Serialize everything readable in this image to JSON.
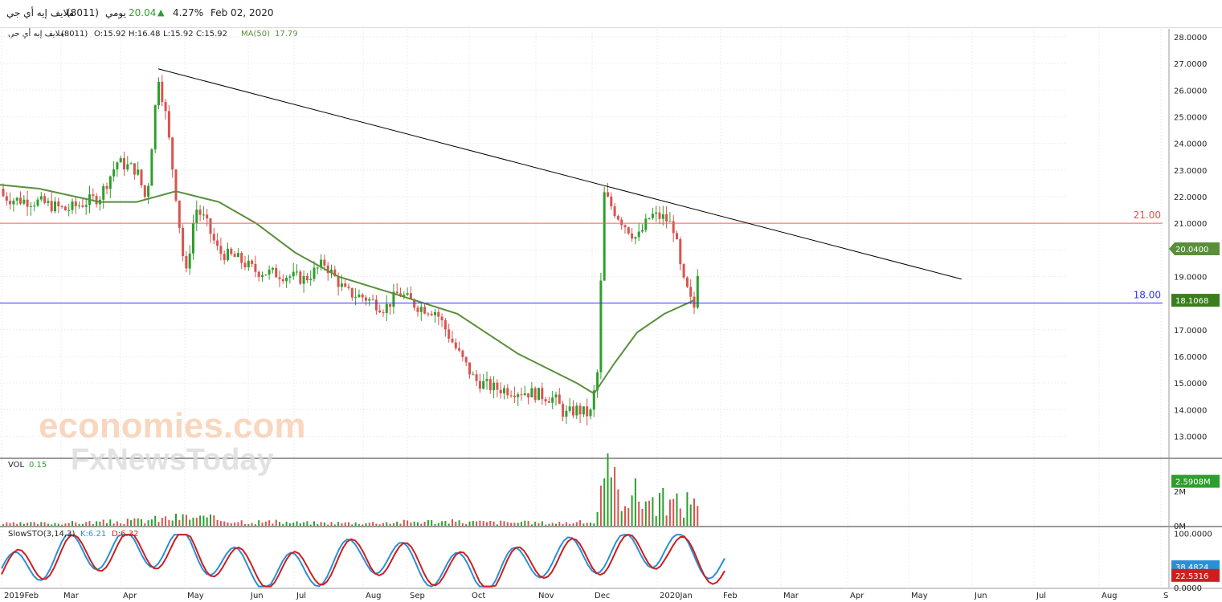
{
  "header": {
    "symbol": "ملايف إيه أي جي",
    "code": "(8011)",
    "period": "يومي",
    "last": "20.04",
    "change_pct": "4.27%",
    "date": "Feb 02, 2020"
  },
  "ohlc_bar": {
    "name": "ملايف إيه أي جي",
    "code": "(8011)",
    "open": "O:15.92",
    "high": "H:16.48",
    "low": "L:15.92",
    "close": "C:15.92",
    "ma_label": "MA(50)",
    "ma_value": "17.79"
  },
  "levels": {
    "resistance": "21.00",
    "support": "18.00"
  },
  "badges": {
    "price": "20.0400",
    "ma": "18.1068",
    "volume": "2.5908M",
    "sto_k": "38.4824",
    "sto_d": "22.5316"
  },
  "vol_panel": {
    "label": "VOL",
    "value": "0.15"
  },
  "sto_panel": {
    "label": "SlowSTO(3,14,3)",
    "k": "K:6.21",
    "d": "D:6.32"
  },
  "watermark": {
    "line1": "economies.com",
    "line2": "FxNewsToday"
  },
  "colors": {
    "up": "#2e9e2e",
    "down": "#d9534f",
    "ma": "#5a8f3a",
    "resistance": "#ff5a5a",
    "support": "#3333ff",
    "trend": "#000000",
    "sto_k": "#2b8fd6",
    "sto_d": "#cc1f1f"
  },
  "chart_data": [
    {
      "type": "candlestick",
      "title": "ملايف إيه أي جي (8011)",
      "x_ticks": [
        "2019Feb",
        "Mar",
        "Apr",
        "May",
        "Jun",
        "Jul",
        "Aug",
        "Sep",
        "Oct",
        "Nov",
        "Dec",
        "2020Jan",
        "Feb",
        "Mar",
        "Apr",
        "May",
        "Jun",
        "Jul",
        "Aug",
        "S"
      ],
      "y_ticks": [
        "28.0000",
        "27.0000",
        "26.0000",
        "25.0000",
        "24.0000",
        "23.0000",
        "22.0000",
        "21.0000",
        "20.0000",
        "19.0000",
        "18.0000",
        "17.0000",
        "16.0000",
        "15.0000",
        "14.0000",
        "13.0000"
      ],
      "ylim": [
        12.2,
        28.3
      ],
      "series": [
        {
          "name": "price",
          "x": [
            "2019-02-01",
            "2019-02-15",
            "2019-03-01",
            "2019-03-15",
            "2019-04-01",
            "2019-04-10",
            "2019-04-20",
            "2019-04-25",
            "2019-05-01",
            "2019-05-05",
            "2019-05-10",
            "2019-05-15",
            "2019-05-20",
            "2019-05-25",
            "2019-06-01",
            "2019-06-10",
            "2019-06-20",
            "2019-07-01",
            "2019-07-15",
            "2019-07-25",
            "2019-08-05",
            "2019-08-15",
            "2019-08-25",
            "2019-09-01",
            "2019-09-10",
            "2019-09-20",
            "2019-10-01",
            "2019-10-10",
            "2019-10-20",
            "2019-11-01",
            "2019-11-10",
            "2019-11-20",
            "2019-11-25",
            "2019-12-01",
            "2019-12-08",
            "2019-12-12",
            "2019-12-15",
            "2019-12-20",
            "2019-12-25",
            "2020-01-01",
            "2020-01-08",
            "2020-01-15",
            "2020-01-20",
            "2020-01-24",
            "2020-01-27",
            "2020-01-30",
            "2020-02-02"
          ],
          "y": [
            22.3,
            21.9,
            21.8,
            21.5,
            22.0,
            23.3,
            23.0,
            21.8,
            26.6,
            25.0,
            22.1,
            18.9,
            21.6,
            21.1,
            19.9,
            19.7,
            19.2,
            19.1,
            18.9,
            19.5,
            18.4,
            18.2,
            17.8,
            18.4,
            17.9,
            17.7,
            16.2,
            15.1,
            14.8,
            14.7,
            14.6,
            14.4,
            13.8,
            14.0,
            13.8,
            15.5,
            22.1,
            21.5,
            21.0,
            20.4,
            21.3,
            21.2,
            20.8,
            18.9,
            18.4,
            17.7,
            20.04
          ]
        },
        {
          "name": "MA(50)",
          "x": [
            "2019-02-01",
            "2019-03-01",
            "2019-04-01",
            "2019-04-20",
            "2019-05-10",
            "2019-06-01",
            "2019-06-20",
            "2019-07-10",
            "2019-08-01",
            "2019-09-01",
            "2019-10-01",
            "2019-11-01",
            "2019-12-01",
            "2019-12-10",
            "2019-12-20",
            "2020-01-01",
            "2020-01-15",
            "2020-01-30"
          ],
          "y": [
            22.5,
            22.3,
            21.8,
            21.8,
            22.2,
            21.8,
            21.0,
            19.9,
            19.0,
            18.3,
            17.6,
            16.1,
            15.0,
            14.6,
            15.7,
            16.9,
            17.6,
            18.1
          ]
        },
        {
          "name": "trendline",
          "x": [
            "2019-05-01",
            "2020-06-15"
          ],
          "y": [
            26.8,
            18.9
          ]
        },
        {
          "name": "resistance",
          "y": 21.0
        },
        {
          "name": "support",
          "y": 18.0
        }
      ],
      "grid": true
    },
    {
      "type": "bar",
      "title": "VOL",
      "y_ticks": [
        "2M",
        "0M"
      ],
      "x": [
        "2019-02",
        "2019-03",
        "2019-04",
        "2019-05",
        "2019-06",
        "2019-07",
        "2019-08",
        "2019-09",
        "2019-10",
        "2019-11",
        "2019-12-10",
        "2019-12-16",
        "2019-12-20",
        "2019-12-26",
        "2020-01-05",
        "2020-01-15",
        "2020-01-25",
        "2020-02-02"
      ],
      "values": [
        0.15,
        0.2,
        0.3,
        0.6,
        0.3,
        0.2,
        0.2,
        0.3,
        0.25,
        0.2,
        0.25,
        3.1,
        2.8,
        2.4,
        1.9,
        1.6,
        1.4,
        2.59
      ],
      "ylim": [
        0,
        3.6
      ]
    },
    {
      "type": "line",
      "title": "SlowSTO(3,14,3)",
      "y_ticks": [
        "100.0000",
        "0.0000"
      ],
      "ylim": [
        0,
        110
      ],
      "series": [
        {
          "name": "K",
          "x": [
            "2019-02",
            "2019-03",
            "2019-04",
            "2019-05",
            "2019-06",
            "2019-07",
            "2019-08",
            "2019-09",
            "2019-10",
            "2019-11",
            "2019-12",
            "2020-01",
            "2020-02"
          ],
          "values": [
            15,
            75,
            85,
            90,
            20,
            15,
            75,
            30,
            5,
            60,
            70,
            90,
            38.48
          ]
        },
        {
          "name": "D",
          "x": [
            "2019-02",
            "2019-03",
            "2019-04",
            "2019-05",
            "2019-06",
            "2019-07",
            "2019-08",
            "2019-09",
            "2019-10",
            "2019-11",
            "2019-12",
            "2020-01",
            "2020-02"
          ],
          "values": [
            20,
            70,
            80,
            85,
            25,
            18,
            70,
            35,
            8,
            55,
            65,
            85,
            22.53
          ]
        }
      ]
    }
  ]
}
